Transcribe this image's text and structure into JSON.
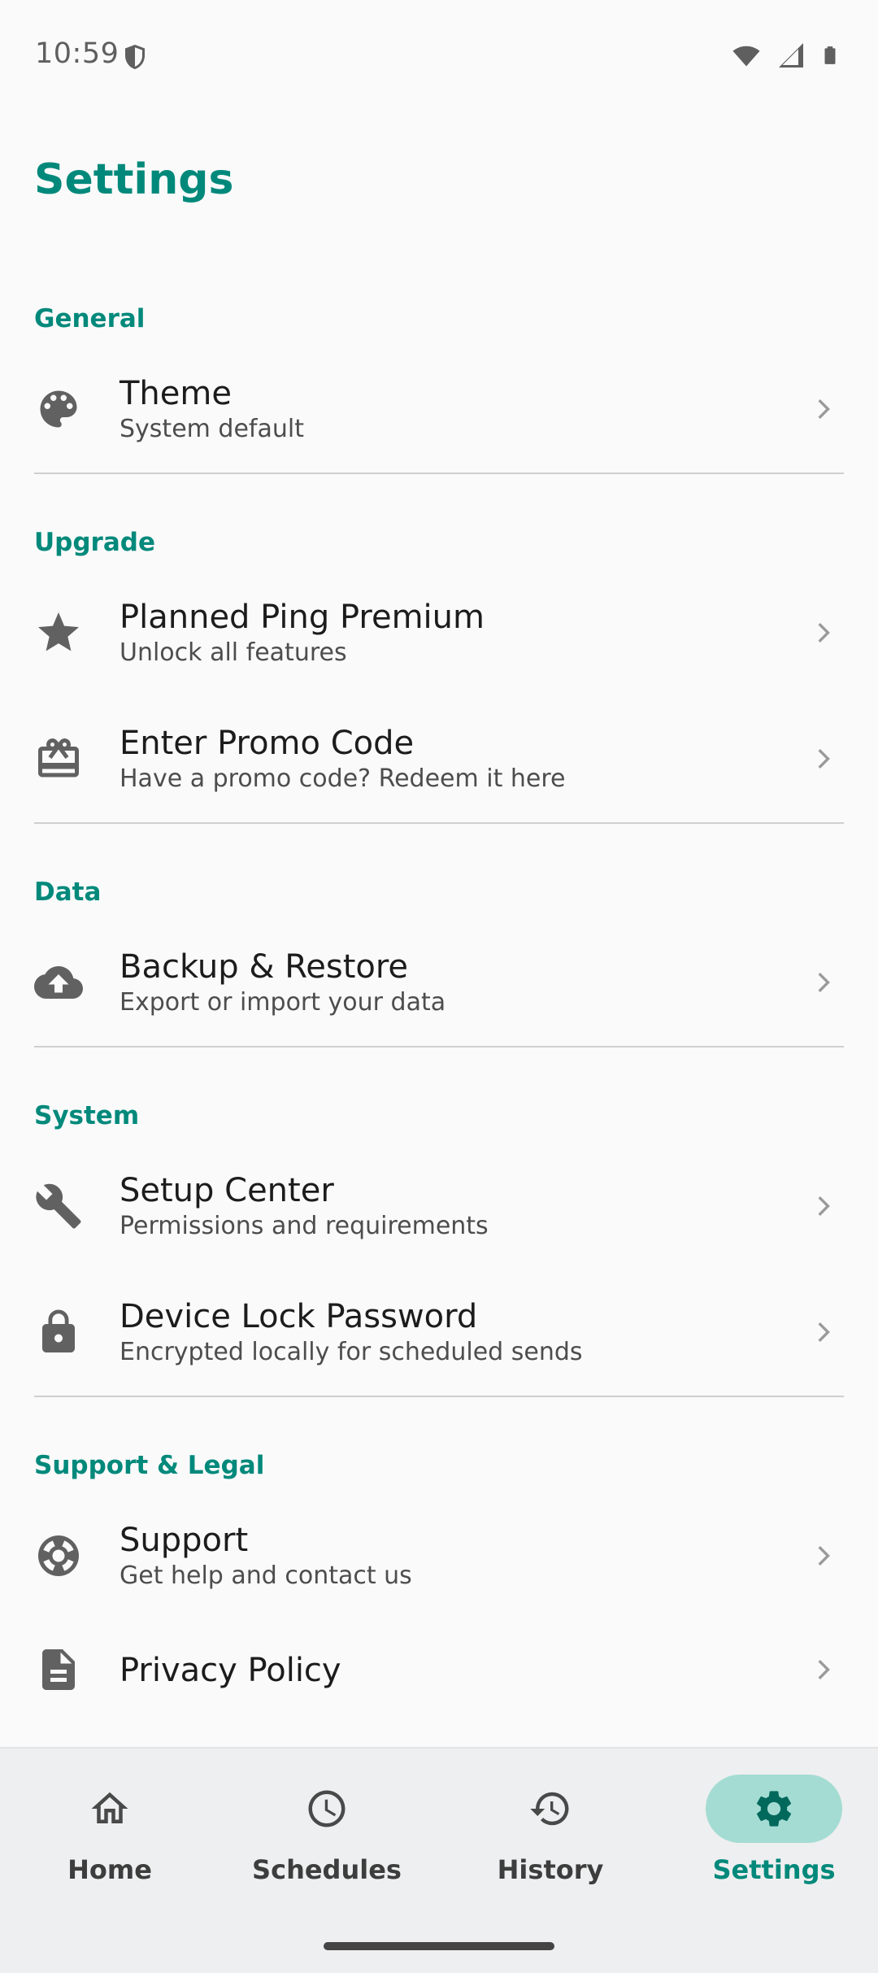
{
  "status_bar": {
    "time": "10:59",
    "icons": [
      "shield-icon",
      "wifi-icon",
      "cellular-icon",
      "battery-icon"
    ]
  },
  "page_title": "Settings",
  "colors": {
    "accent": "#00897b",
    "nav_active_pill": "#a4dcd3",
    "icon_gray": "#616161"
  },
  "sections": [
    {
      "header": "General",
      "items": [
        {
          "icon": "palette-icon",
          "title": "Theme",
          "subtitle": "System default"
        }
      ]
    },
    {
      "header": "Upgrade",
      "items": [
        {
          "icon": "star-icon",
          "title": "Planned Ping Premium",
          "subtitle": "Unlock all features"
        },
        {
          "icon": "gift-card-icon",
          "title": "Enter Promo Code",
          "subtitle": "Have a promo code? Redeem it here"
        }
      ]
    },
    {
      "header": "Data",
      "items": [
        {
          "icon": "cloud-upload-icon",
          "title": "Backup & Restore",
          "subtitle": "Export or import your data"
        }
      ]
    },
    {
      "header": "System",
      "items": [
        {
          "icon": "wrench-icon",
          "title": "Setup Center",
          "subtitle": "Permissions and requirements"
        },
        {
          "icon": "lock-icon",
          "title": "Device Lock Password",
          "subtitle": "Encrypted locally for scheduled sends"
        }
      ]
    },
    {
      "header": "Support & Legal",
      "items": [
        {
          "icon": "lifebuoy-icon",
          "title": "Support",
          "subtitle": "Get help and contact us"
        },
        {
          "icon": "document-icon",
          "title": "Privacy Policy",
          "subtitle": ""
        }
      ]
    }
  ],
  "bottom_nav": [
    {
      "label": "Home",
      "icon": "home-icon",
      "active": false
    },
    {
      "label": "Schedules",
      "icon": "clock-icon",
      "active": false
    },
    {
      "label": "History",
      "icon": "history-icon",
      "active": false
    },
    {
      "label": "Settings",
      "icon": "gear-icon",
      "active": true
    }
  ]
}
